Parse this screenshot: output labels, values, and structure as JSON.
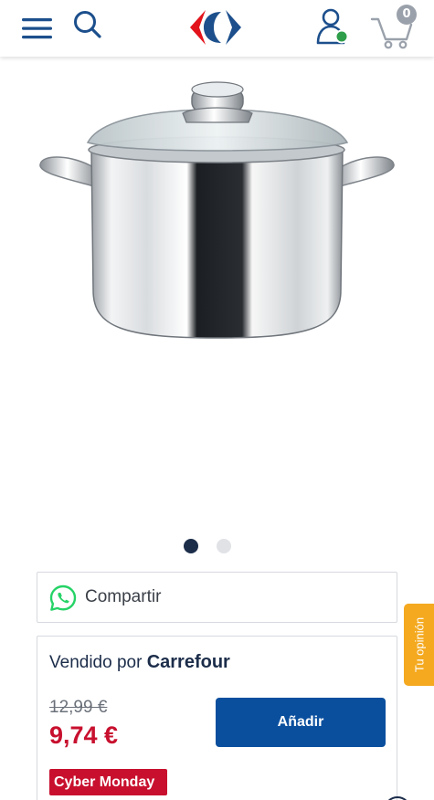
{
  "header": {
    "menu_icon": "hamburger-menu-icon",
    "search_icon": "search-icon",
    "logo_icon": "carrefour-logo",
    "account_icon": "user-account-icon",
    "cart_icon": "shopping-cart-icon",
    "cart_count": "0"
  },
  "gallery": {
    "image": "stainless-steel-stockpot-with-glass-lid",
    "slides": 2,
    "active_slide": 1
  },
  "share": {
    "icon": "whatsapp-icon",
    "label": "Compartir"
  },
  "seller": {
    "prefix": "Vendido por",
    "name": "Carrefour",
    "old_price": "12,99 €",
    "price": "9,74 €",
    "add_label": "Añadir",
    "promo_label": "Cyber Monday"
  },
  "feedback": {
    "label": "Tu opinión"
  },
  "colors": {
    "navy": "#1c2d4a",
    "button_blue": "#0a4f9e",
    "price_red": "#c8102e",
    "feedback_orange": "#f4a91f",
    "online_green": "#2e9e4a",
    "whatsapp_green": "#25d366"
  }
}
